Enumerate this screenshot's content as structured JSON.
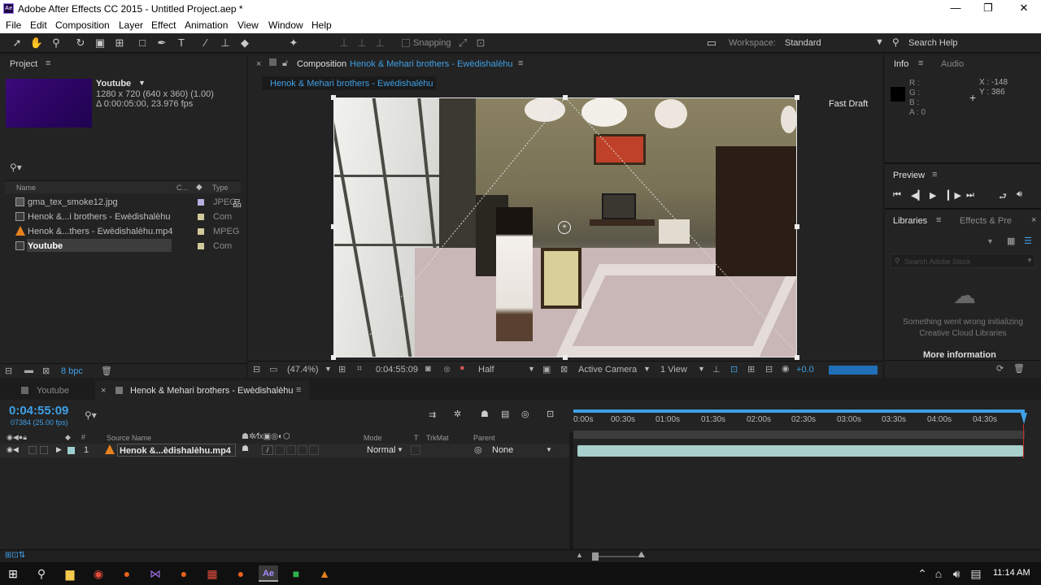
{
  "window": {
    "title": "Adobe After Effects CC 2015 - Untitled Project.aep *",
    "app_icon": "Ae"
  },
  "menu": [
    "File",
    "Edit",
    "Composition",
    "Layer",
    "Effect",
    "Animation",
    "View",
    "Window",
    "Help"
  ],
  "toolbar": {
    "snapping": "Snapping",
    "workspace_label": "Workspace:",
    "workspace_value": "Standard",
    "search_help": "Search Help"
  },
  "project": {
    "title": "Project",
    "selected_name": "Youtube",
    "selected_info1": "1280 x 720  (640 x 360) (1.00)",
    "selected_info2": "Δ 0:00:05:00, 23.976 fps",
    "col_name": "Name",
    "col_type": "Type",
    "items": [
      {
        "name": "gma_tex_smoke12.jpg",
        "type": "JPEG",
        "color": "#b8b0e0"
      },
      {
        "name": "Henok &...i brothers - Ewèdishalèhu",
        "type": "Com",
        "color": "#cfc89a"
      },
      {
        "name": "Henok &...thers - Ewèdishalèhu.mp4",
        "type": "MPEG",
        "color": "#cfc89a"
      },
      {
        "name": "Youtube",
        "type": "Com",
        "color": "#cfc89a"
      }
    ],
    "bpc": "8 bpc"
  },
  "composition": {
    "tab_prefix": "Composition",
    "tab_name": "Henok & Mehari brothers - Ewèdishalèhu",
    "breadcrumb": "Henok & Mehari brothers - Ewèdishalèhu",
    "fast_draft": "Fast Draft",
    "zoom": "(47.4%)",
    "timecode": "0:04:55:09",
    "resolution": "Half",
    "camera": "Active Camera",
    "views": "1 View",
    "exposure": "+0.0"
  },
  "info": {
    "tab": "Info",
    "tab2": "Audio",
    "r": "R :",
    "g": "G :",
    "b": "B :",
    "a": "A : 0",
    "x": "X : -148",
    "y": "Y : 386"
  },
  "preview": {
    "title": "Preview"
  },
  "libraries": {
    "tab": "Libraries",
    "tab2": "Effects & Pre",
    "search_placeholder": "Search Adobe Stock",
    "error": "Something went wrong initializing Creative Cloud Libraries",
    "more": "More information"
  },
  "timeline": {
    "tab1": "Youtube",
    "tab2": "Henok & Mehari brothers - Ewèdishalèhu",
    "timecode": "0:04:55:09",
    "frames": "07384 (25.00 fps)",
    "col_source": "Source Name",
    "col_mode": "Mode",
    "col_t": "T",
    "col_trkmat": "TrkMat",
    "col_parent": "Parent",
    "layer_num": "1",
    "layer_name": "Henok &...èdishalèhu.mp4",
    "layer_mode": "Normal",
    "layer_parent": "None",
    "ruler": [
      "0:00s",
      "00:30s",
      "01:00s",
      "01:30s",
      "02:00s",
      "02:30s",
      "03:00s",
      "03:30s",
      "04:00s",
      "04:30s"
    ]
  },
  "taskbar": {
    "time": "11:14 AM"
  }
}
